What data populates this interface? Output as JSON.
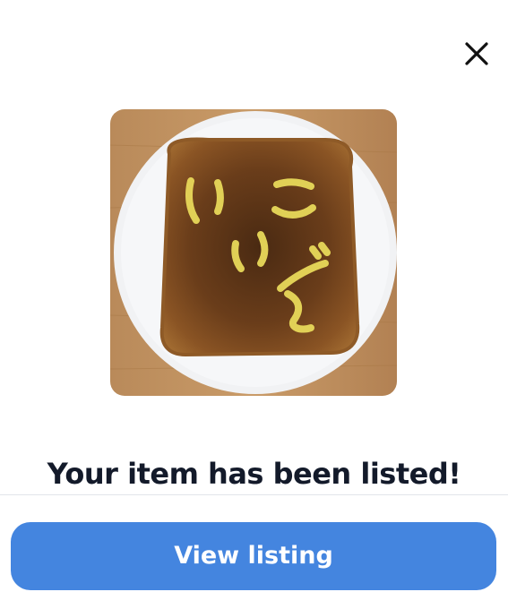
{
  "dialog": {
    "close_icon": "close-icon",
    "item_photo_icon": "toast-photo",
    "headline": "Your item has been listed!",
    "primary_button_label": "View listing"
  },
  "colors": {
    "background": "#ffffff",
    "headline_text": "#131a2a",
    "primary_button": "#4485df",
    "primary_button_text": "#ffffff",
    "divider": "#e2e5ea"
  }
}
